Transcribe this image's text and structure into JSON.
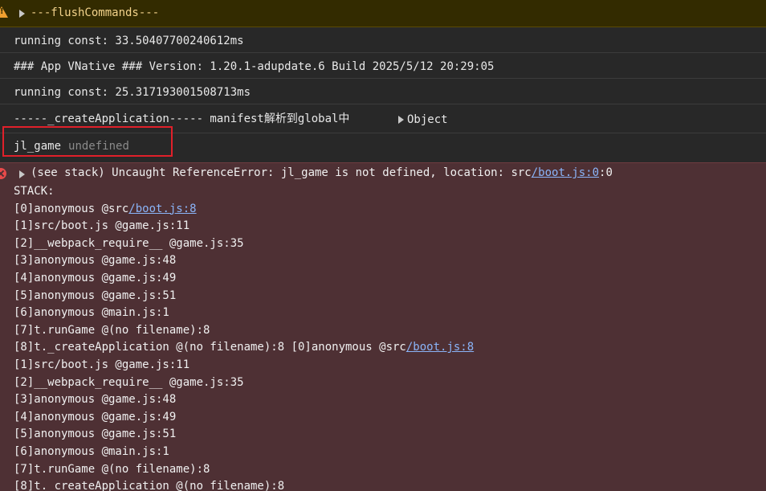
{
  "warning": {
    "text": "---flushCommands---"
  },
  "logs": {
    "running_const_1": "running const: 33.50407700240612ms",
    "app_version": "### App VNative ### Version: 1.20.1-adupdate.6 Build 2025/5/12 20:29:05",
    "running_const_2": "running const: 25.317193001508713ms",
    "create_app": "-----_createApplication----- manifest解析到global中",
    "object_label": "Object",
    "jl_game_name": "jl_game",
    "jl_game_value": "undefined"
  },
  "error": {
    "prefix": "(see stack) Uncaught ReferenceError: jl_game is not defined, location: src",
    "location_link": "/boot.js:0",
    "suffix": ":0",
    "stack_label": "STACK:",
    "frames": [
      {
        "text": "[0]anonymous @src",
        "link": "/boot.js:8"
      },
      {
        "text": "[1]src/boot.js @game.js:11"
      },
      {
        "text": "[2]__webpack_require__ @game.js:35"
      },
      {
        "text": "[3]anonymous @game.js:48"
      },
      {
        "text": "[4]anonymous @game.js:49"
      },
      {
        "text": "[5]anonymous @game.js:51"
      },
      {
        "text": "[6]anonymous @main.js:1"
      },
      {
        "text": "[7]t.runGame @(no filename):8"
      },
      {
        "text": "[8]t._createApplication @(no filename):8 [0]anonymous @src",
        "link": "/boot.js:8"
      },
      {
        "text": "[1]src/boot.js @game.js:11"
      },
      {
        "text": "[2]__webpack_require__ @game.js:35"
      },
      {
        "text": "[3]anonymous @game.js:48"
      },
      {
        "text": "[4]anonymous @game.js:49"
      },
      {
        "text": "[5]anonymous @game.js:51"
      },
      {
        "text": "[6]anonymous @main.js:1"
      },
      {
        "text": "[7]t.runGame @(no filename):8"
      },
      {
        "text": "[8]t._createApplication @(no filename):8"
      }
    ]
  },
  "colors": {
    "warning_bg": "#332b00",
    "error_bg": "#4e3034",
    "link": "#8ab4f8",
    "highlight_box": "#e0202a"
  }
}
